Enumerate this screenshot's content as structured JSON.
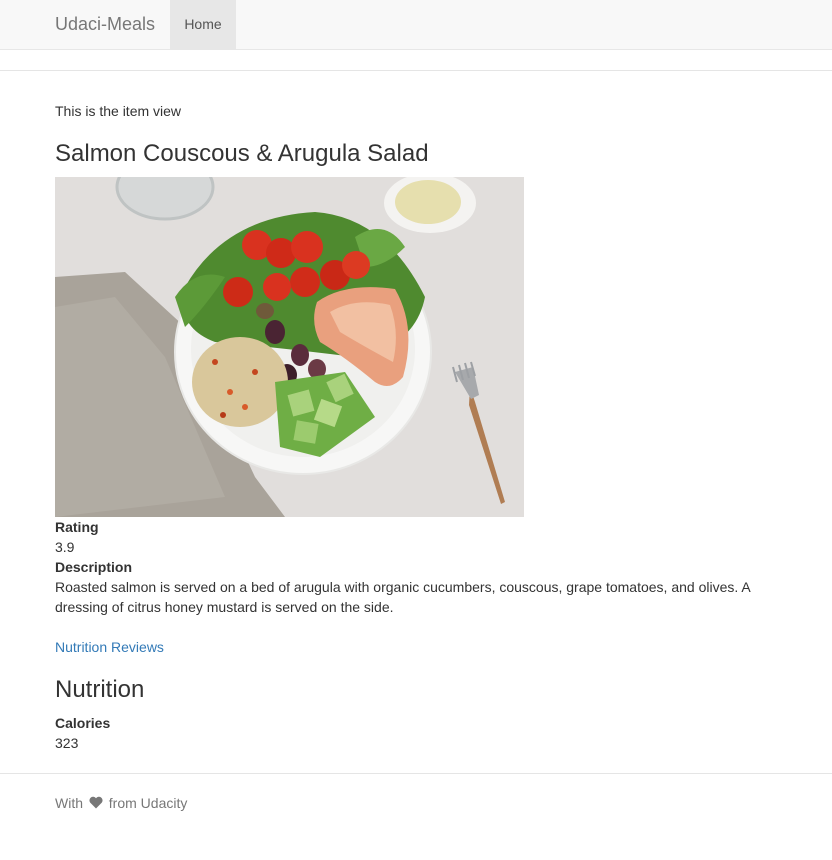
{
  "navbar": {
    "brand": "Udaci-Meals",
    "home_label": "Home"
  },
  "main": {
    "intro_text": "This is the item view",
    "item_title": "Salmon Couscous & Arugula Salad",
    "rating_label": "Rating",
    "rating_value": "3.9",
    "description_label": "Description",
    "description_text": "Roasted salmon is served on a bed of arugula with organic cucumbers, couscous, grape tomatoes, and olives. A dressing of citrus honey mustard is served on the side.",
    "reviews_link": "Nutrition Reviews",
    "nutrition_heading": "Nutrition",
    "calories_label": "Calories",
    "calories_value": "323"
  },
  "footer": {
    "prefix": "With",
    "suffix": "from Udacity",
    "icon": "heart-icon"
  },
  "colors": {
    "link": "#337ab7",
    "navbar_bg": "#f8f8f8",
    "text": "#333333",
    "muted": "#777777"
  }
}
